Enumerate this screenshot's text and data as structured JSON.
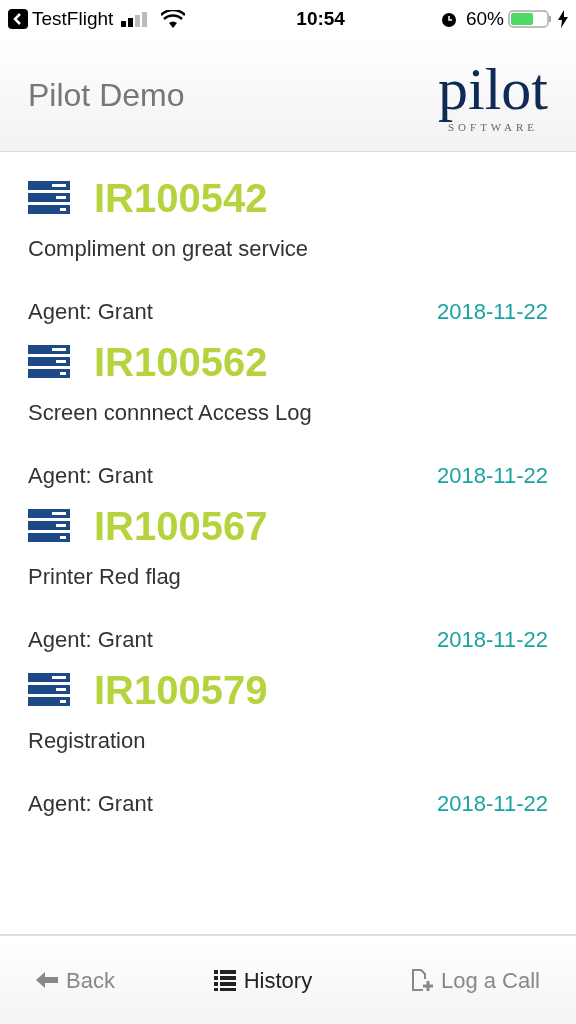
{
  "status_bar": {
    "back_app": "TestFlight",
    "time": "10:54",
    "battery": "60%"
  },
  "header": {
    "title": "Pilot Demo",
    "logo": {
      "word": "pilot",
      "tagline": "SOFTWARE"
    }
  },
  "incidents": [
    {
      "id": "IR100542",
      "subject": "Compliment on great service",
      "agent": "Agent: Grant",
      "date": "2018-11-22"
    },
    {
      "id": "IR100562",
      "subject": "Screen connnect Access Log",
      "agent": "Agent: Grant",
      "date": "2018-11-22"
    },
    {
      "id": "IR100567",
      "subject": "Printer Red flag",
      "agent": "Agent: Grant",
      "date": "2018-11-22"
    },
    {
      "id": "IR100579",
      "subject": "Registration",
      "agent": "Agent: Grant",
      "date": "2018-11-22"
    }
  ],
  "tabs": [
    {
      "kind": "back",
      "label": "Back",
      "selected": false
    },
    {
      "kind": "history",
      "label": "History",
      "selected": true
    },
    {
      "kind": "log",
      "label": "Log a Call",
      "selected": false
    }
  ]
}
